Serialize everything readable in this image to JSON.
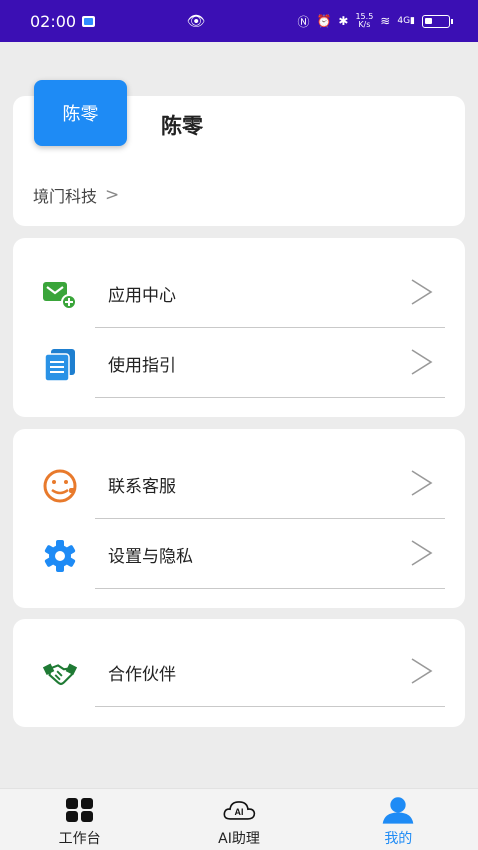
{
  "status_bar": {
    "time": "02:00",
    "speed_value": "15.5",
    "speed_unit": "K/s",
    "network": "4G"
  },
  "profile": {
    "avatar_text": "陈零",
    "name": "陈零",
    "organization": "境门科技",
    "chevron": ">"
  },
  "menu": {
    "app_center": "应用中心",
    "user_guide": "使用指引",
    "customer_service": "联系客服",
    "settings_privacy": "设置与隐私",
    "partners": "合作伙伴"
  },
  "tabs": {
    "workbench": "工作台",
    "ai_assistant": "AI助理",
    "mine": "我的",
    "ai_badge": "AI"
  },
  "colors": {
    "status_bar": "#3b0fb4",
    "accent": "#1e8bf5",
    "green": "#3aa53a",
    "orange": "#e87a2c"
  }
}
